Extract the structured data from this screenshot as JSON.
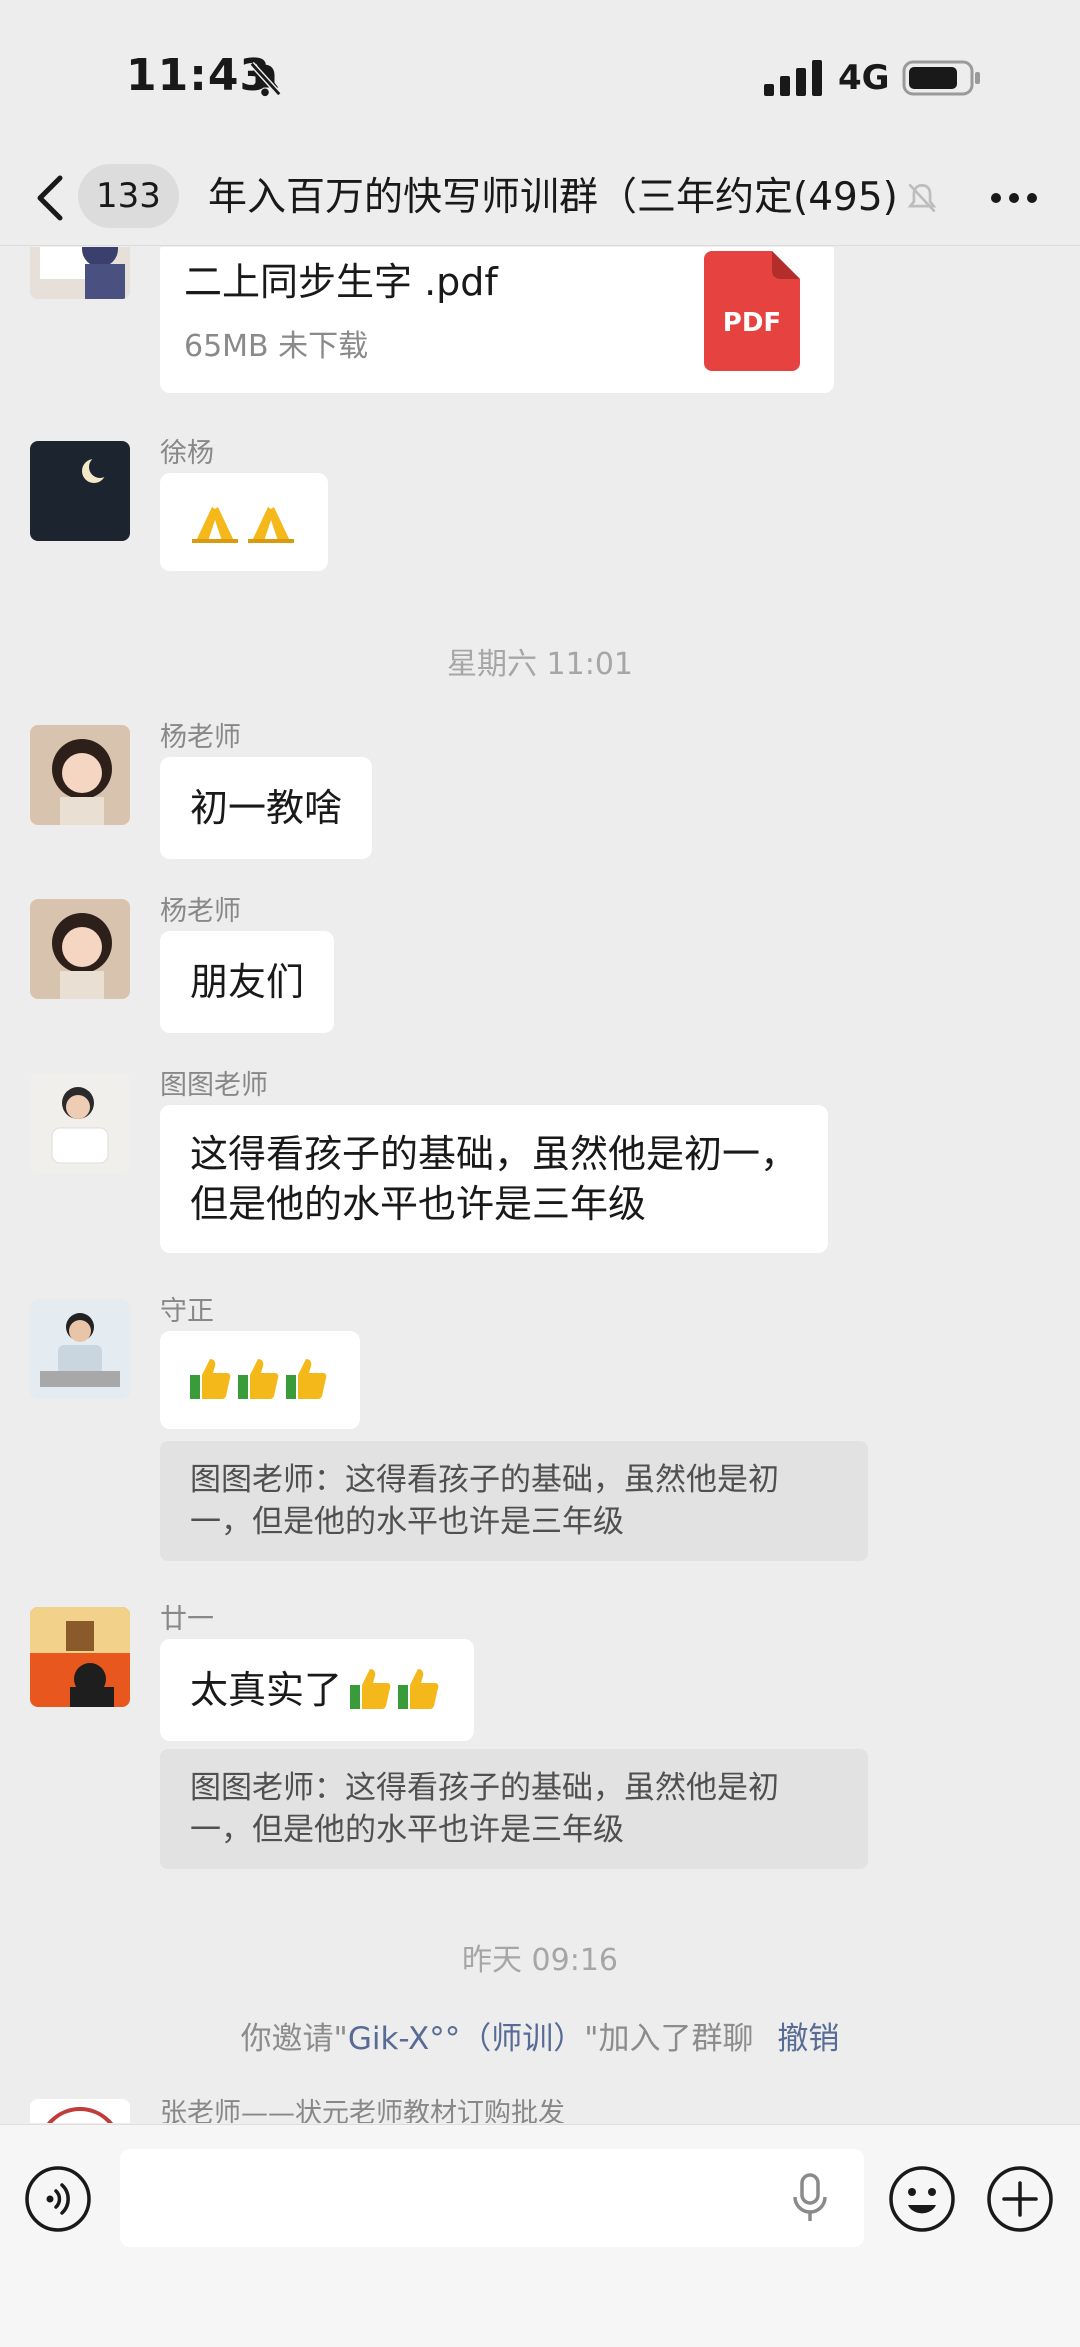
{
  "status_bar": {
    "time": "11:43",
    "network": "4G"
  },
  "nav": {
    "back_count": "133",
    "title": "年入百万的快写师训群（三年约定",
    "member_count": "(495)"
  },
  "messages": {
    "file": {
      "name": "二上同步生字 .pdf",
      "meta": "65MB  未下载",
      "icon_label": "PDF"
    },
    "m1": {
      "sender": "徐杨",
      "icon": "folded-hands-emoji"
    },
    "ts1": "星期六 11:01",
    "m2": {
      "sender": "杨老师",
      "text": "初一教啥"
    },
    "m3": {
      "sender": "杨老师",
      "text": "朋友们"
    },
    "m4": {
      "sender": "图图老师",
      "line1": "这得看孩子的基础，虽然他是初一，",
      "line2": "但是他的水平也许是三年级"
    },
    "m5": {
      "sender": "守正",
      "icon": "thumbs-up-emoji",
      "quote_line1": "图图老师：这得看孩子的基础，虽然他是初",
      "quote_line2": "一，但是他的水平也许是三年级"
    },
    "m6": {
      "sender": "廿一",
      "text": "太真实了",
      "quote_line1": "图图老师：这得看孩子的基础，虽然他是初",
      "quote_line2": "一，但是他的水平也许是三年级"
    },
    "ts2": "昨天 09:16",
    "sys": {
      "prefix": "你邀请\"",
      "name": "Gik-X°°（师训）",
      "suffix": "\"加入了群聊",
      "action": "撤销"
    },
    "m7": {
      "sender": "张老师——状元老师教材订购批发"
    }
  },
  "colors": {
    "background": "#ededed",
    "bubble": "#ffffff",
    "link": "#576b95",
    "pdf": "#e64340"
  }
}
